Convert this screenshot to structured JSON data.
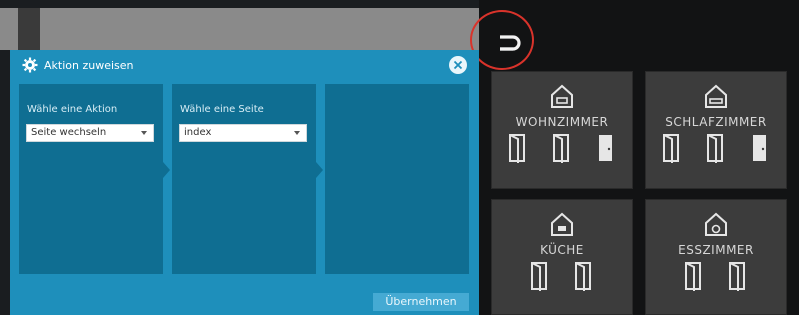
{
  "dialog": {
    "title": "Aktion zuweisen",
    "columns": [
      {
        "label": "Wähle eine Aktion",
        "selected": "Seite wechseln"
      },
      {
        "label": "Wähle eine Seite",
        "selected": "index"
      },
      {
        "label": "",
        "selected": ""
      }
    ],
    "apply_label": "Übernehmen"
  },
  "rooms": [
    {
      "name": "WOHNZIMMER"
    },
    {
      "name": "SCHLAFZIMMER"
    },
    {
      "name": "KÜCHE"
    },
    {
      "name": "ESSZIMMER"
    }
  ],
  "colors": {
    "dialog_bg": "#1e8fbb",
    "column_bg": "#0f6e92",
    "tile_bg": "#3c3c3c",
    "highlight": "#d9332b"
  }
}
